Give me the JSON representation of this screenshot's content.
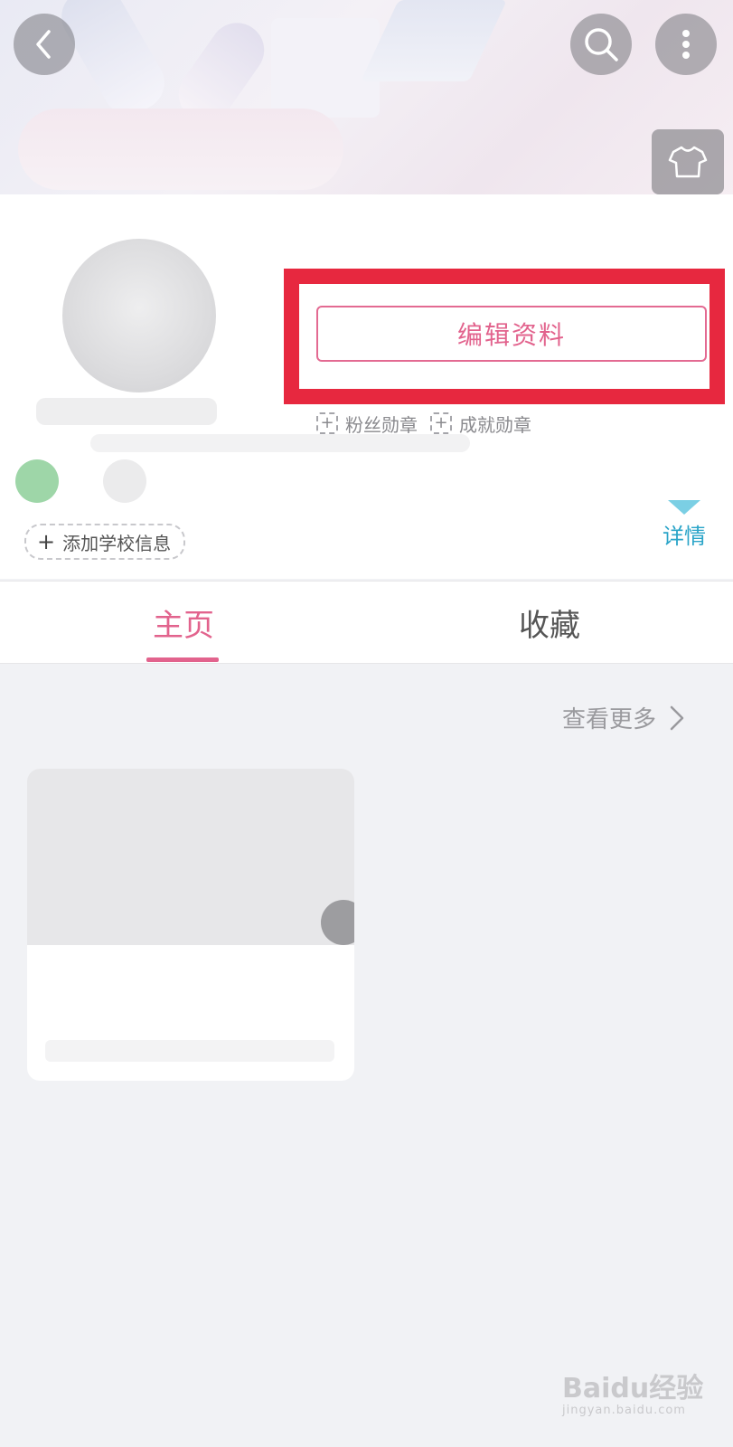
{
  "header": {
    "back_icon": "chevron-left-icon",
    "search_icon": "search-icon",
    "more_icon": "more-vertical-icon",
    "skin_icon": "tshirt-icon"
  },
  "profile": {
    "edit_button_label": "编辑资料",
    "badges": [
      {
        "label": "粉丝勋章"
      },
      {
        "label": "成就勋章"
      }
    ],
    "add_school_label": "添加学校信息",
    "detail_label": "详情"
  },
  "tabs": [
    {
      "label": "主页",
      "active": true
    },
    {
      "label": "收藏",
      "active": false
    }
  ],
  "content": {
    "see_more_label": "查看更多"
  },
  "watermark": {
    "brand": "Baidu经验",
    "url": "jingyan.baidu.com"
  },
  "colors": {
    "accent": "#e2638d",
    "highlight_box": "#e7283f",
    "detail_link": "#2aa4c8",
    "background": "#f1f2f5"
  }
}
